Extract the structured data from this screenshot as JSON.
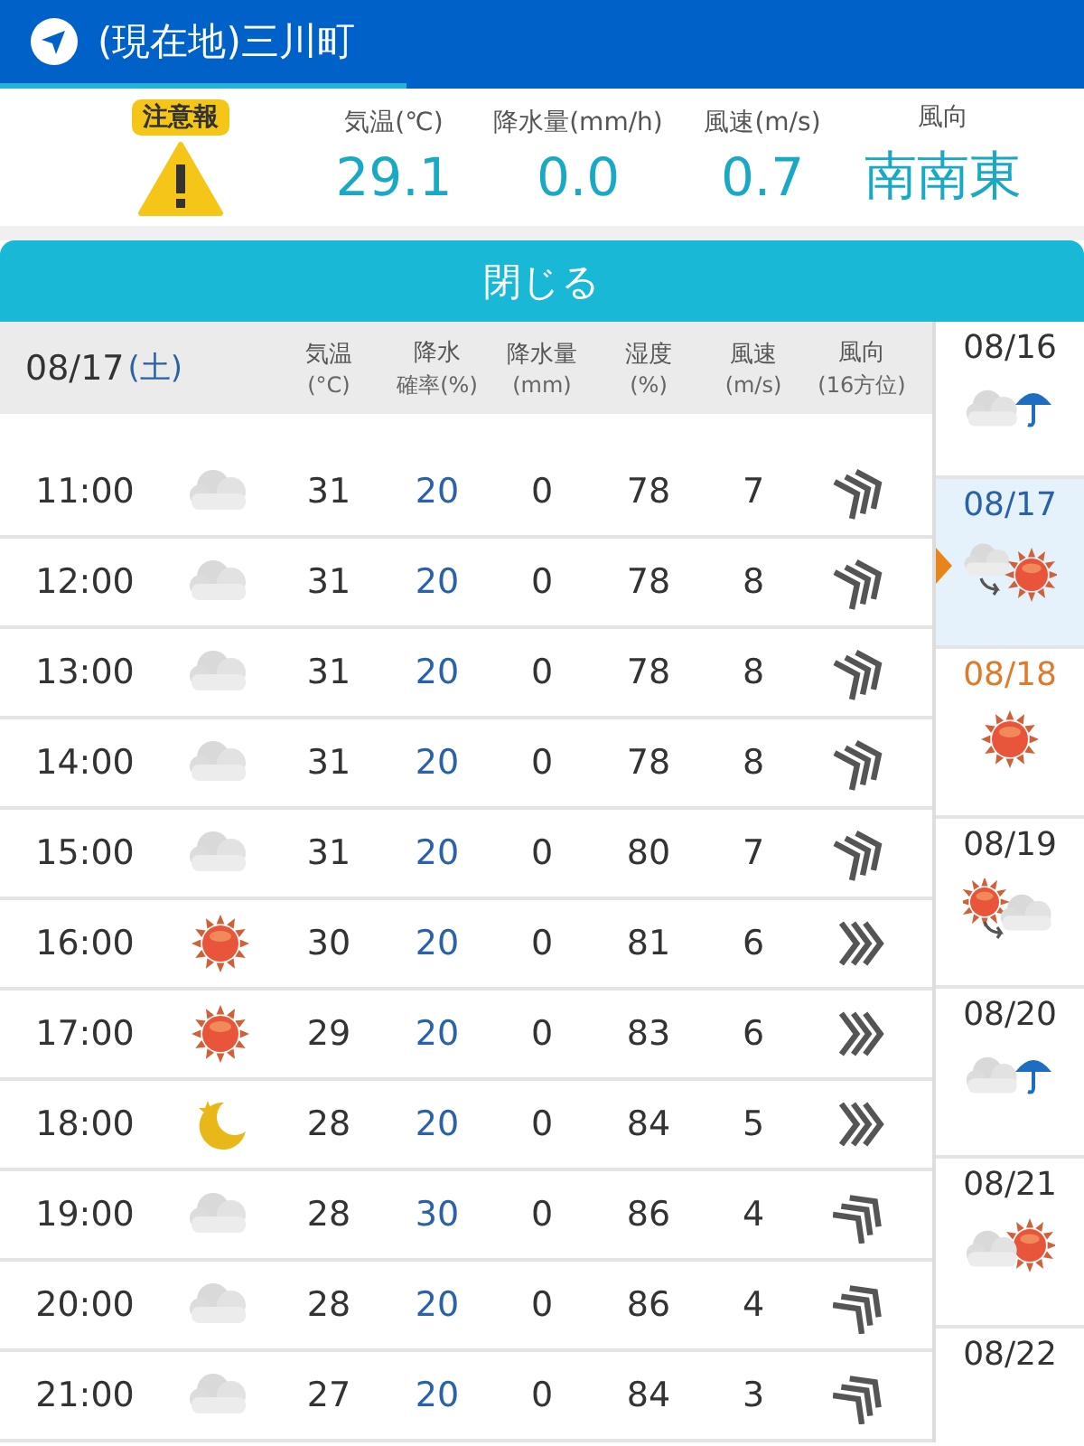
{
  "location": {
    "title": "(現在地)三川町"
  },
  "current": {
    "alert": "注意報",
    "readings": [
      {
        "label": "気温(℃)",
        "value": "29.1"
      },
      {
        "label": "降水量(mm/h)",
        "value": "0.0"
      },
      {
        "label": "風速(m/s)",
        "value": "0.7"
      },
      {
        "label": "風向",
        "value": "南南東"
      }
    ]
  },
  "close_button": "閉じる",
  "table": {
    "date": "08/17",
    "weekday": "(土)",
    "columns": [
      {
        "line1": "気温",
        "line2": "(°C)"
      },
      {
        "line1": "降水",
        "line2": "確率(%)"
      },
      {
        "line1": "降水量",
        "line2": "(mm)"
      },
      {
        "line1": "湿度",
        "line2": "(%)"
      },
      {
        "line1": "風速",
        "line2": "(m/s)"
      },
      {
        "line1": "風向",
        "line2": "(16方位)"
      }
    ],
    "rows": [
      {
        "time": "11:00",
        "kind": "cloudy",
        "temp": "31",
        "prob": "20",
        "amount": "0",
        "humidity": "78",
        "wind": "7",
        "wind_icon": {
          "kind": "tilted"
        }
      },
      {
        "time": "12:00",
        "kind": "cloudy",
        "temp": "31",
        "prob": "20",
        "amount": "0",
        "humidity": "78",
        "wind": "8",
        "wind_icon": {
          "kind": "tilted"
        }
      },
      {
        "time": "13:00",
        "kind": "cloudy",
        "temp": "31",
        "prob": "20",
        "amount": "0",
        "humidity": "78",
        "wind": "8",
        "wind_icon": {
          "kind": "tilted"
        }
      },
      {
        "time": "14:00",
        "kind": "cloudy",
        "temp": "31",
        "prob": "20",
        "amount": "0",
        "humidity": "78",
        "wind": "8",
        "wind_icon": {
          "kind": "tilted"
        }
      },
      {
        "time": "15:00",
        "kind": "cloudy",
        "temp": "31",
        "prob": "20",
        "amount": "0",
        "humidity": "80",
        "wind": "7",
        "wind_icon": {
          "kind": "tilted"
        }
      },
      {
        "time": "16:00",
        "kind": "sunny",
        "temp": "30",
        "prob": "20",
        "amount": "0",
        "humidity": "81",
        "wind": "6",
        "wind_icon": {
          "kind": "straight"
        }
      },
      {
        "time": "17:00",
        "kind": "sunny",
        "temp": "29",
        "prob": "20",
        "amount": "0",
        "humidity": "83",
        "wind": "6",
        "wind_icon": {
          "kind": "straight"
        }
      },
      {
        "time": "18:00",
        "kind": "moon",
        "temp": "28",
        "prob": "20",
        "amount": "0",
        "humidity": "84",
        "wind": "5",
        "wind_icon": {
          "kind": "straight"
        }
      },
      {
        "time": "19:00",
        "kind": "cloudy",
        "temp": "28",
        "prob": "30",
        "amount": "0",
        "humidity": "86",
        "wind": "4",
        "wind_icon": {
          "kind": "steep"
        }
      },
      {
        "time": "20:00",
        "kind": "cloudy",
        "temp": "28",
        "prob": "20",
        "amount": "0",
        "humidity": "86",
        "wind": "4",
        "wind_icon": {
          "kind": "steep"
        }
      },
      {
        "time": "21:00",
        "kind": "cloudy",
        "temp": "27",
        "prob": "20",
        "amount": "0",
        "humidity": "84",
        "wind": "3",
        "wind_icon": {
          "kind": "steep"
        }
      }
    ]
  },
  "days": [
    {
      "date": "08/16",
      "kind": "cloud_umbrella",
      "selected": false,
      "color": "#333333"
    },
    {
      "date": "08/17",
      "kind": "cloud_to_sun",
      "selected": true,
      "color": "#2a62a8"
    },
    {
      "date": "08/18",
      "kind": "sun",
      "selected": false,
      "color": "#e07a2a"
    },
    {
      "date": "08/19",
      "kind": "sun_to_cloud",
      "selected": false,
      "color": "#333333"
    },
    {
      "date": "08/20",
      "kind": "cloud_umbrella",
      "selected": false,
      "color": "#333333"
    },
    {
      "date": "08/21",
      "kind": "cloud_sun",
      "selected": false,
      "color": "#333333"
    },
    {
      "date": "08/22",
      "selected": false,
      "color": "#333333"
    }
  ]
}
